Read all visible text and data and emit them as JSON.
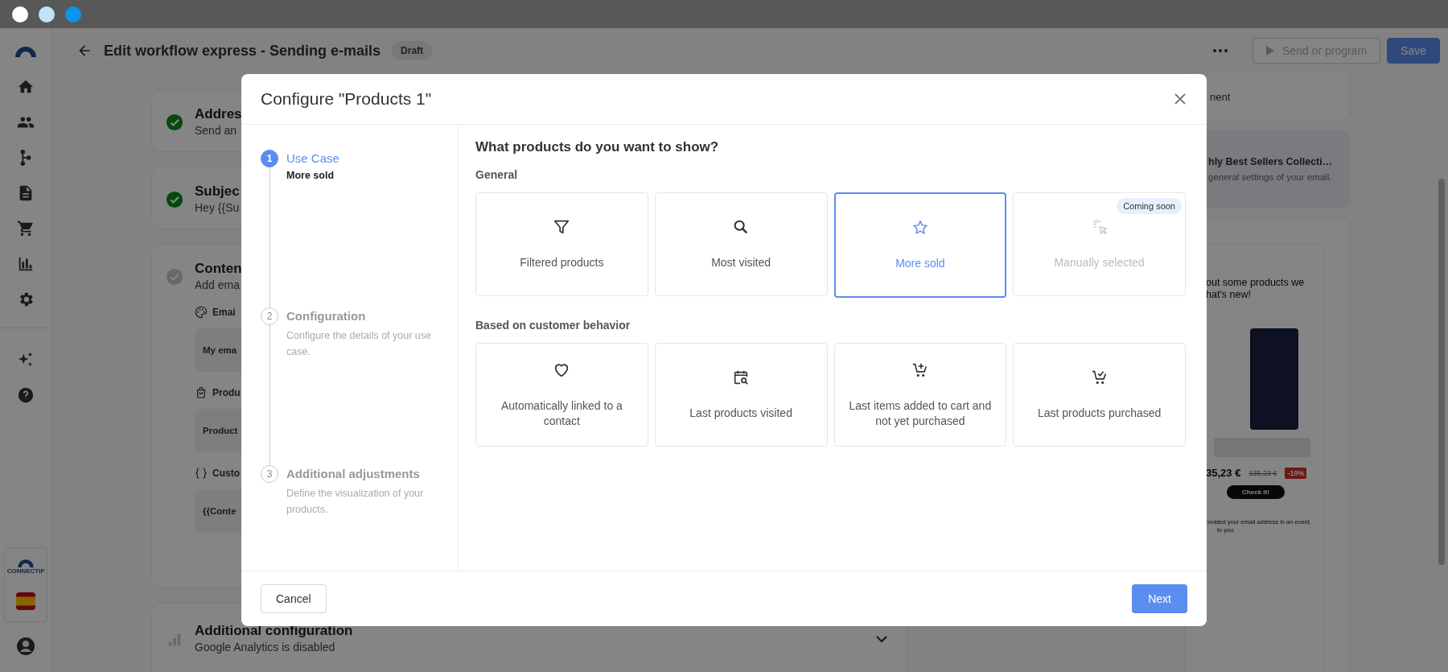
{
  "header": {
    "title": "Edit workflow express - Sending e-mails",
    "badge": "Draft",
    "buttons": [
      {
        "label": "Send or program",
        "kind": "secondary",
        "disabled": true
      },
      {
        "label": "Save",
        "kind": "primary",
        "disabled": false
      }
    ]
  },
  "nav": {
    "brand": "CONNECTIF"
  },
  "sections": [
    {
      "kind": "step",
      "title": "Addres",
      "subtitle": "Send an",
      "done": true
    },
    {
      "kind": "step",
      "title": "Subjec",
      "subtitle": "Hey {{Su",
      "done": true
    },
    {
      "kind": "step",
      "title": "Conten",
      "subtitle": "Add ema",
      "done": false,
      "fields": [
        {
          "label": "Emai",
          "value": "My ema"
        },
        {
          "label": "Produ",
          "value": "Product"
        },
        {
          "label": "Custo",
          "value": "{{Conte"
        }
      ]
    },
    {
      "kind": "settings",
      "title": "Additional configuration",
      "subtitle": "Google Analytics is disabled",
      "expanded": false
    }
  ],
  "side_panel": {
    "item": "nent",
    "template": {
      "title": "hly Best Sellers Collecti…",
      "text": "general settings of your email."
    },
    "preview": {
      "intro_lines": [
        "out some products we",
        "hat's new!"
      ],
      "price": "35,23 €",
      "old_price": "135,23 €",
      "discount": "-10%",
      "button": "Check it!",
      "footer_lines": [
        "rovided your email address in an event,",
        "to you."
      ]
    }
  },
  "dialog": {
    "title": "Configure \"Products 1\"",
    "steps": [
      {
        "number": "1",
        "title": "Use Case",
        "detail": "More sold",
        "selected": true
      },
      {
        "number": "2",
        "title": "Configuration",
        "detail": "Configure the details of your use case.",
        "selected": false
      },
      {
        "number": "3",
        "title": "Additional adjustments",
        "detail": "Define the visualization of your products.",
        "selected": false
      }
    ],
    "question": "What products do you want to show?",
    "groups": [
      {
        "title": "General",
        "options": [
          {
            "label": "Filtered products",
            "selected": false,
            "disabled": false
          },
          {
            "label": "Most visited",
            "selected": false,
            "disabled": false
          },
          {
            "label": "More sold",
            "selected": true,
            "disabled": false
          },
          {
            "label": "Manually selected",
            "selected": false,
            "disabled": true,
            "badge": "Coming soon"
          }
        ]
      },
      {
        "title": "Based on customer behavior",
        "options": [
          {
            "label": "Automatically linked to a contact",
            "selected": false,
            "disabled": false
          },
          {
            "label": "Last products visited",
            "selected": false,
            "disabled": false
          },
          {
            "label": "Last items added to cart and not yet purchased",
            "selected": false,
            "disabled": false
          },
          {
            "label": "Last products purchased",
            "selected": false,
            "disabled": false
          }
        ]
      }
    ],
    "cancel": "Cancel",
    "next": "Next"
  }
}
